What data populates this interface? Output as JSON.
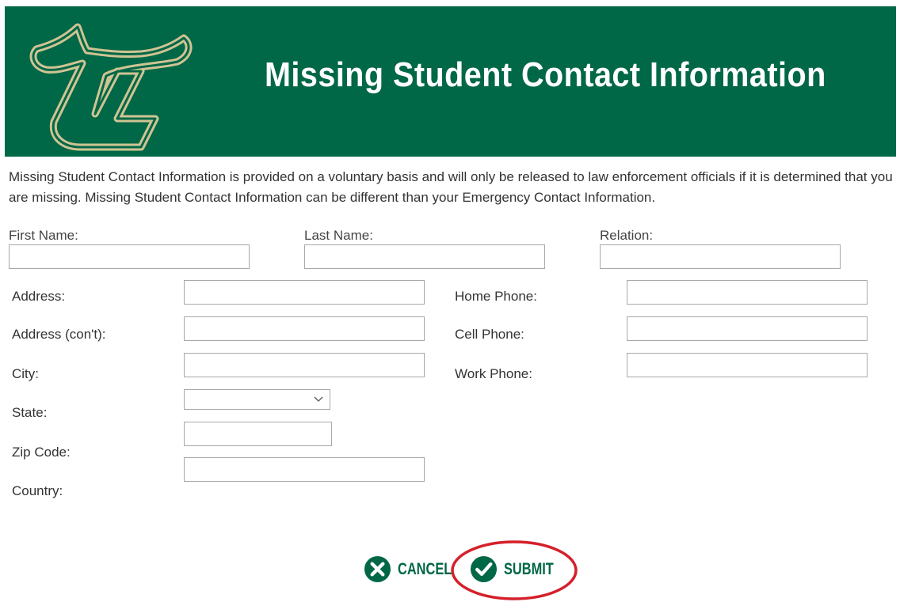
{
  "theme": {
    "brand": "#006747",
    "logo_gold": "#cfc493",
    "highlight_red": "#d4202a"
  },
  "header": {
    "title": "Missing Student Contact Information",
    "logo_icon": "usf-bull-logo-icon"
  },
  "intro": "Missing Student Contact Information is provided on a voluntary basis and will only be released to law enforcement officials if it is determined that you are missing. Missing Student Contact Information can be different than your Emergency Contact Information.",
  "form": {
    "first_name": {
      "label": "First Name:",
      "value": ""
    },
    "last_name": {
      "label": "Last Name:",
      "value": ""
    },
    "relation": {
      "label": "Relation:",
      "value": ""
    },
    "address": {
      "label": "Address:",
      "value": ""
    },
    "address2": {
      "label": "Address (con't):",
      "value": ""
    },
    "city": {
      "label": "City:",
      "value": ""
    },
    "state": {
      "label": "State:",
      "value": ""
    },
    "zip": {
      "label": "Zip Code:",
      "value": ""
    },
    "country": {
      "label": "Country:",
      "value": ""
    },
    "home_phone": {
      "label": "Home Phone:",
      "value": ""
    },
    "cell_phone": {
      "label": "Cell Phone:",
      "value": ""
    },
    "work_phone": {
      "label": "Work Phone:",
      "value": ""
    }
  },
  "actions": {
    "cancel_label": "CANCEL",
    "cancel_icon": "x-circle-icon",
    "submit_label": "SUBMIT",
    "submit_icon": "check-circle-icon",
    "submit_highlighted": true
  }
}
